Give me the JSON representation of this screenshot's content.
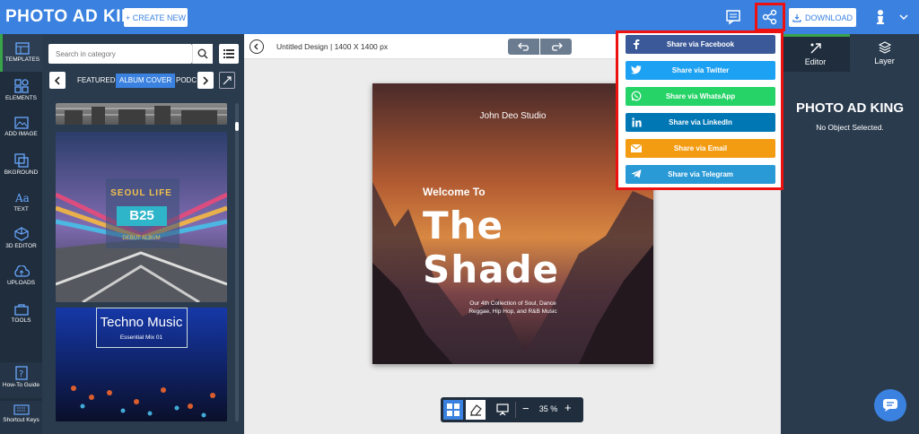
{
  "topbar": {
    "logo": "PHOTO AD KING",
    "create_label": "+ CREATE NEW",
    "download_label": "DOWNLOAD"
  },
  "leftnav": {
    "items": [
      {
        "label": "TEMPLATES",
        "icon": "templates-icon"
      },
      {
        "label": "ELEMENTS",
        "icon": "elements-icon"
      },
      {
        "label": "ADD IMAGE",
        "icon": "image-icon"
      },
      {
        "label": "BKGROUND",
        "icon": "background-icon"
      },
      {
        "label": "TEXT",
        "icon": "text-icon"
      },
      {
        "label": "3D EDITOR",
        "icon": "3d-icon"
      },
      {
        "label": "UPLOADS",
        "icon": "upload-icon"
      },
      {
        "label": "TOOLS",
        "icon": "tools-icon"
      },
      {
        "label": "How-To Guide",
        "icon": "guide-icon"
      },
      {
        "label": "Shortcut Keys",
        "icon": "keyboard-icon"
      }
    ]
  },
  "panel": {
    "search_placeholder": "Search in category",
    "categories": [
      "FEATURED",
      "ALBUM COVER",
      "PODC"
    ],
    "active_category": "ALBUM COVER",
    "thumb1": {
      "title": "SEOUL LIFE",
      "code": "B25",
      "sub": "DEBUT ALBUM"
    },
    "thumb2": {
      "title": "Techno Music",
      "sub": "Essential Mix 01"
    }
  },
  "doc": {
    "title": "Untitled Design | 1400 X 1400 px"
  },
  "design": {
    "studio": "John Deo Studio",
    "welcome": "Welcome To",
    "headline": "The Shade",
    "body_line1": "Our 4th Collection of Soul, Dance",
    "body_line2": "Reggae, Hip Hop, and R&B Music"
  },
  "zoom": {
    "label": "35 %"
  },
  "share": {
    "items": [
      {
        "label": "Share via Facebook",
        "color": "#3b5998"
      },
      {
        "label": "Share via Twitter",
        "color": "#1da1f2"
      },
      {
        "label": "Share via WhatsApp",
        "color": "#25d366"
      },
      {
        "label": "Share via LinkedIn",
        "color": "#0077b5"
      },
      {
        "label": "Share via Email",
        "color": "#f39c12"
      },
      {
        "label": "Share via Telegram",
        "color": "#2a9ad6"
      }
    ]
  },
  "right_panel": {
    "tab_editor": "Editor",
    "tab_layer": "Layer",
    "logo": "PHOTO AD KING",
    "empty_text": "No Object Selected."
  }
}
